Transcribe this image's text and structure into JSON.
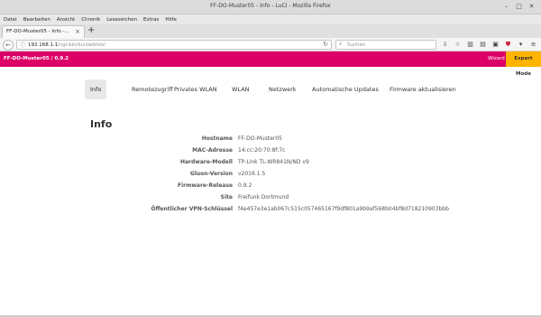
{
  "window": {
    "title": "FF-DO-Muster05 - Info - LuCI - Mozilla Firefox"
  },
  "menubar": {
    "items": [
      "Datei",
      "Bearbeiten",
      "Ansicht",
      "Chronik",
      "Lesezeichen",
      "Extras",
      "Hilfe"
    ]
  },
  "browser_tab": {
    "label": "FF-DO-Muster05 - Info -...",
    "close": "×",
    "new_tab": "+"
  },
  "urlbar": {
    "host": "192.168.1.1",
    "path": "/cgi-bin/luci/admin/"
  },
  "searchbar": {
    "placeholder": "Suchen"
  },
  "toolbar_icons": [
    "download-icon",
    "star-icon",
    "bookmarks-icon",
    "reader-icon",
    "screenshot-icon",
    "shield-icon",
    "menu-icon"
  ],
  "luci_header": {
    "hostname": "FF-DO-Muster05 / 0.9.2",
    "wizard": "Wizard",
    "expert": "Expert Mode",
    "accent": "#dc0067",
    "expert_color": "#ffb400"
  },
  "nav_tabs": [
    "Info",
    "Remotezugriff",
    "Privates WLAN",
    "WLAN",
    "Netzwerk",
    "Automatische Updates",
    "Firmware aktualisieren"
  ],
  "active_tab": "Info",
  "page_title": "Info",
  "info": [
    {
      "key": "Hostname",
      "value": "FF-DO-Muster05"
    },
    {
      "key": "MAC-Adresse",
      "value": "14:cc:20:70:8f:7c"
    },
    {
      "key": "Hardware-Modell",
      "value": "TP-Link TL-WR841N/ND v9"
    },
    {
      "key": "Gluon-Version",
      "value": "v2016.1.5"
    },
    {
      "key": "Firmware-Release",
      "value": "0.9.2"
    },
    {
      "key": "Site",
      "value": "Freifunk Dortmund"
    },
    {
      "key": "Öffentlicher VPN-Schlüssel",
      "value": "f4e457e3e1ab067c515c057465167f9df801a9b9af568b04bf8d718210903bbb"
    }
  ]
}
